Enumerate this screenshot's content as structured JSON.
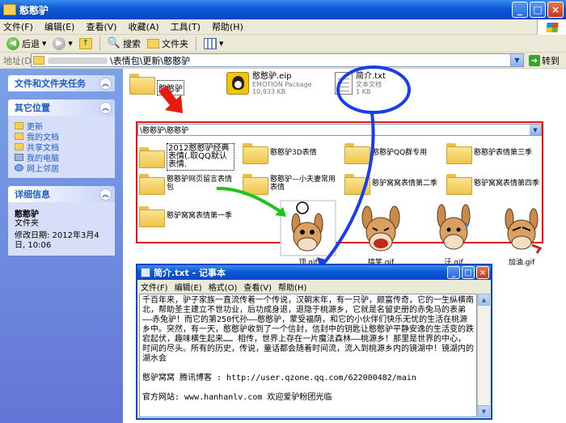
{
  "window": {
    "title": "憨憨驴"
  },
  "menu": [
    "文件(F)",
    "编辑(E)",
    "查看(V)",
    "收藏(A)",
    "工具(T)",
    "帮助(H)"
  ],
  "toolbar": {
    "back": "后退",
    "search": "搜索",
    "folders": "文件夹"
  },
  "address": {
    "label": "地址(D)",
    "path_tail": "\\表情包\\更新\\憨憨驴",
    "go": "转到"
  },
  "left_pane": {
    "tasks_title": "文件和文件夹任务",
    "other_title": "其它位置",
    "other_places": [
      "更新",
      "我的文档",
      "共享文档",
      "我的电脑",
      "网上邻居"
    ],
    "details_title": "详细信息",
    "details": {
      "name": "憨憨驴",
      "type": "文件夹",
      "modified": "修改日期: 2012年3月4日, 10:06"
    }
  },
  "files": {
    "folder_name": "憨憨驴",
    "zip": {
      "name": "憨憨驴.eip",
      "type": "EMOTION Package",
      "size": "10,933 KB"
    },
    "txt": {
      "name": "简介.txt",
      "type": "文本文档",
      "size": "1 KB"
    }
  },
  "subfolder": {
    "path": "\\憨憨驴\\憨憨驴",
    "folders": [
      "2012憨憨驴经典表情(.取QQ默认表情.",
      "憨憨驴3D表情",
      "憨憨驴QQ群专用",
      "憨憨驴表情第三季",
      "憨憨驴网页留言表情包",
      "憨憨驴—小夫妻常用表情",
      "憨驴窝窝表情第二季",
      "憨驴窝窝表情第四季",
      "憨驴窝窝表情第一季"
    ]
  },
  "gifs": [
    "顶.gif",
    "搞笑.gif",
    "汗.gif",
    "加油.gif"
  ],
  "notepad": {
    "title": "简介.txt - 记事本",
    "menu": [
      "文件(F)",
      "编辑(E)",
      "格式(O)",
      "查看(V)",
      "帮助(H)"
    ],
    "text": "千百年来，驴子家族一直流传着一个传说，汉朝末年，有一只驴，颇富传奇，它的一生纵横南北，帮助圣主建立不世功业，后功成身退，退隐于桃源乡，它就是名留史册的赤兔马的表弟——赤兔驴！而它的第250代孙——憨憨驴，蒙受福荫，和它的小伙伴们快乐无忧的生活在桃源乡中。突然，有一天，憨憨驴收到了一个信封，信封中的钥匙让憨憨驴平静安逸的生活变的跌宕起伏，趣味横生起来…… 相传，世界上存在一片魔法森林——桃源乡！那里是世界的中心，时间的尽头。所有的历史，传说，童话都会随着时间流，流入到桃源乡内的镜湖中！镜湖内的湖水会\n\n憨驴窝窝 腾讯博客 : http://user.qzone.qq.com/622000482/main\n\n官方网站: www.hanhanlv.com 欢迎爱驴粉团光临"
  }
}
